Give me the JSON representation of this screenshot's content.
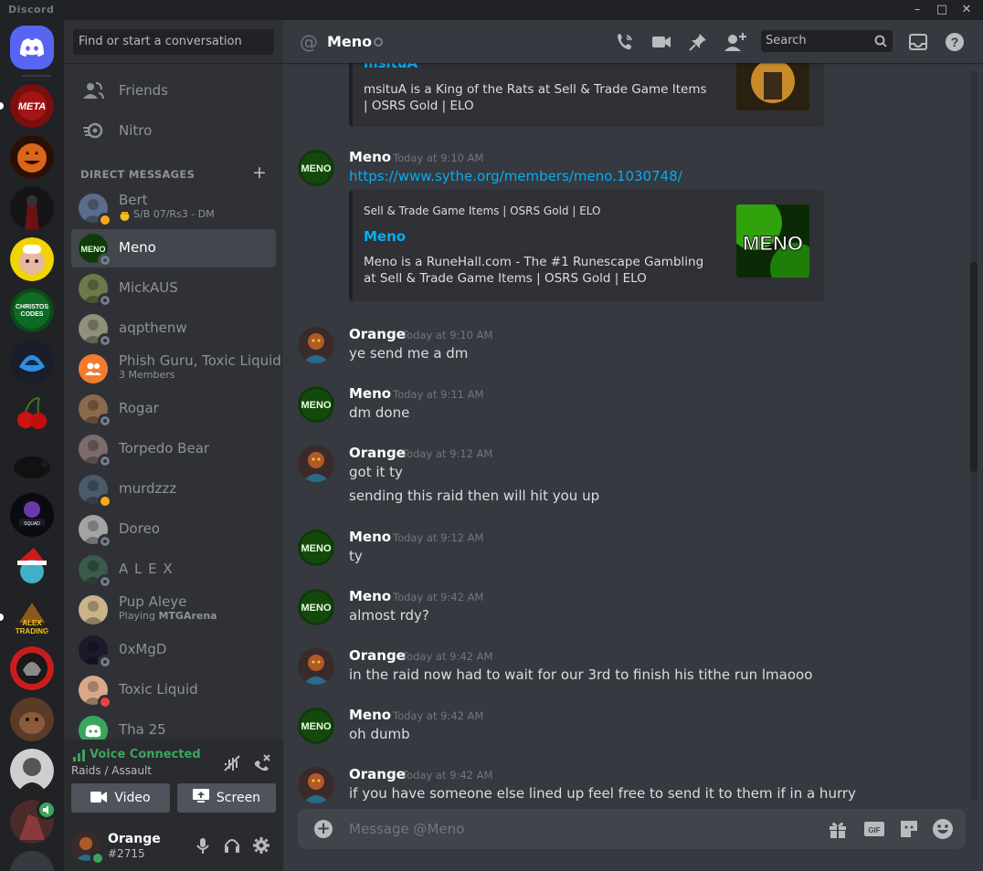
{
  "window": {
    "title": "Discord",
    "controls": [
      "minimize",
      "maximize",
      "close"
    ]
  },
  "servers": [
    {
      "name": "home-discord-icon"
    },
    {
      "name": "META",
      "label": "META"
    },
    {
      "name": "pumpkin-server"
    },
    {
      "name": "dark-warrior-server"
    },
    {
      "name": "chef-server"
    },
    {
      "name": "christos-codes",
      "label": "CHRISTOS CODES"
    },
    {
      "name": "blue-helmet-server"
    },
    {
      "name": "cherry-server"
    },
    {
      "name": "rat-server"
    },
    {
      "name": "squad-server"
    },
    {
      "name": "santa-server"
    },
    {
      "name": "alex-trading",
      "label": "ALEX TRADING"
    },
    {
      "name": "helmet-server"
    },
    {
      "name": "dog-server"
    },
    {
      "name": "portrait-server"
    },
    {
      "name": "voice-server"
    }
  ],
  "sidebar": {
    "search_placeholder": "Find or start a conversation",
    "nav": [
      {
        "label": "Friends",
        "icon": "friends-icon"
      },
      {
        "label": "Nitro",
        "icon": "nitro-icon"
      }
    ],
    "dm_header": "DIRECT MESSAGES",
    "dm_add": "+",
    "dms": [
      {
        "name": "Bert",
        "sub": "S/B 07/Rs3 - DM",
        "status": "idle",
        "color": "#5b6d8a"
      },
      {
        "name": "Meno",
        "status": "offline",
        "color": "#1a5c12",
        "selected": true
      },
      {
        "name": "MickAUS",
        "status": "offline",
        "color": "#6a7a4a"
      },
      {
        "name": "aqpthenw",
        "status": "offline",
        "color": "#8f8f7a"
      },
      {
        "name": "Phish Guru, Toxic Liquid",
        "sub": "3 Members",
        "status": "",
        "color": "#f47b2e"
      },
      {
        "name": "Rogar",
        "status": "offline",
        "color": "#8a6a4a"
      },
      {
        "name": "Torpedo Bear",
        "status": "offline",
        "color": "#7d6a6a"
      },
      {
        "name": "murdzzz",
        "status": "idle",
        "color": "#4a5a6a"
      },
      {
        "name": "Doreo",
        "status": "offline",
        "color": "#a3a3a3"
      },
      {
        "name": "A L E X",
        "status": "offline",
        "color": "#3a5a4a"
      },
      {
        "name": "Pup Aleye",
        "sub_prefix": "Playing ",
        "sub_bold": "MTGArena",
        "status": "",
        "color": "#c9b38a"
      },
      {
        "name": "0xMgD",
        "status": "offline",
        "color": "#1a1a2a"
      },
      {
        "name": "Toxic Liquid",
        "status": "dnd",
        "color": "#d9a88a"
      },
      {
        "name": "Tha 25",
        "status": "",
        "color": "#3ba55d"
      }
    ]
  },
  "voice": {
    "status": "Voice Connected",
    "channel": "Raids / Assault",
    "video_label": "Video",
    "screen_label": "Screen"
  },
  "user": {
    "name": "Orange",
    "tag": "#2715"
  },
  "chat": {
    "channel": "Meno",
    "search_placeholder": "Search",
    "composer_placeholder": "Message @Meno",
    "embed_top": {
      "desc": "msituA is a King of the Rats at Sell & Trade Game Items | OSRS Gold | ELO",
      "title_fragment": "msituA"
    },
    "messages": [
      {
        "author": "Meno",
        "time": "Today at 9:10 AM",
        "link": "https://www.sythe.org/members/meno.1030748/",
        "embed": {
          "provider": "Sell & Trade Game Items | OSRS Gold | ELO",
          "title": "Meno",
          "desc": "Meno is a RuneHall.com - The #1 Runescape Gambling at Sell & Trade Game Items | OSRS Gold | ELO",
          "thumb": "MENO"
        }
      },
      {
        "author": "Orange",
        "time": "Today at 9:10 AM",
        "lines": [
          "ye send me a dm"
        ]
      },
      {
        "author": "Meno",
        "time": "Today at 9:11 AM",
        "lines": [
          "dm done"
        ]
      },
      {
        "author": "Orange",
        "time": "Today at 9:12 AM",
        "lines": [
          "got it ty",
          "sending this raid then will hit you up"
        ]
      },
      {
        "author": "Meno",
        "time": "Today at 9:12 AM",
        "lines": [
          "ty"
        ]
      },
      {
        "author": "Meno",
        "time": "Today at 9:42 AM",
        "lines": [
          "almost rdy?"
        ]
      },
      {
        "author": "Orange",
        "time": "Today at 9:42 AM",
        "lines": [
          "in the raid now had to wait for our 3rd to finish his tithe run lmaooo"
        ]
      },
      {
        "author": "Meno",
        "time": "Today at 9:42 AM",
        "lines": [
          "oh dumb"
        ]
      },
      {
        "author": "Orange",
        "time": "Today at 9:42 AM",
        "lines": [
          "if you have someone else lined up feel free to send it to them if in a hurry"
        ]
      }
    ]
  },
  "colors": {
    "accent": "#5865f2",
    "link": "#00aff4",
    "online": "#3ba55d",
    "idle": "#faa81a",
    "dnd": "#ed4245",
    "offline": "#747f8d"
  }
}
